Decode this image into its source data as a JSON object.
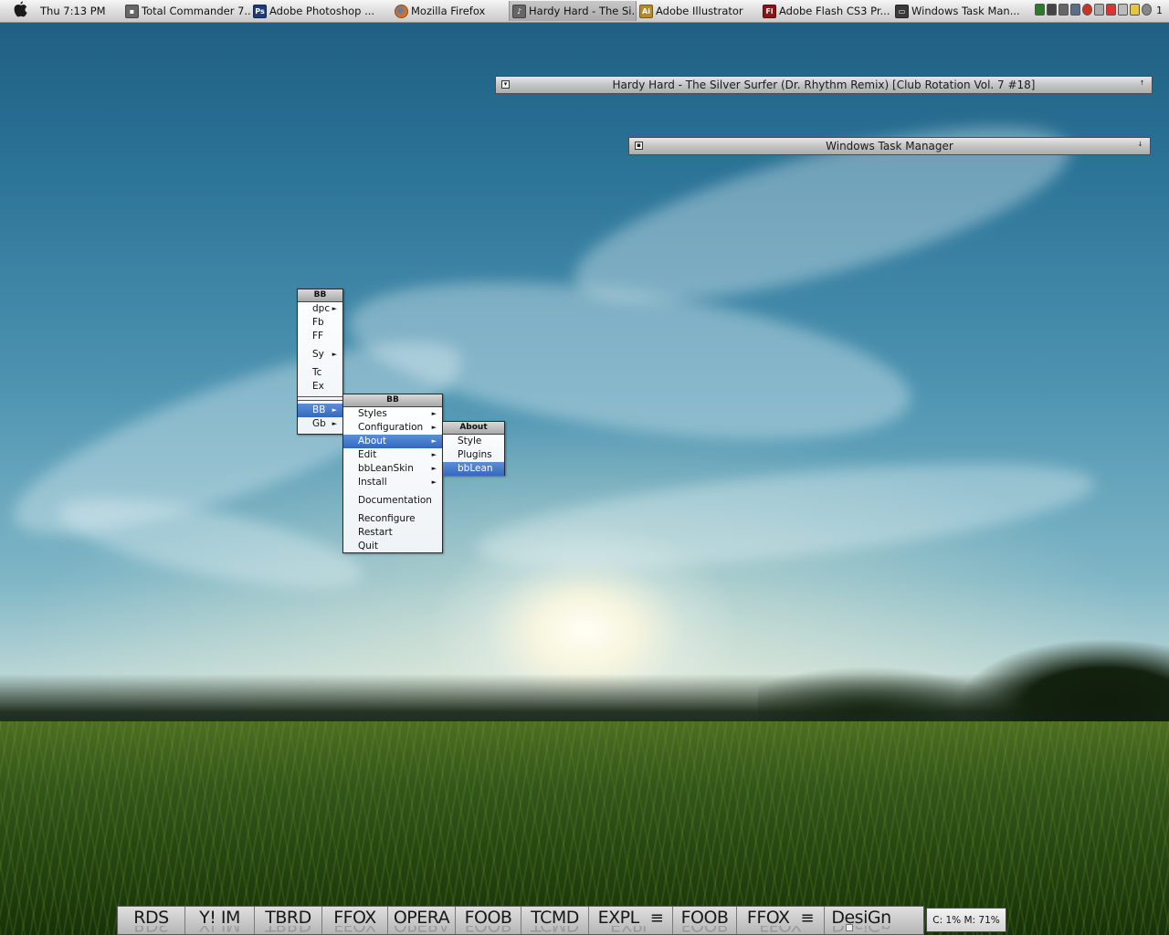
{
  "topbar": {
    "clock": "Thu 7:13 PM",
    "tasks": [
      {
        "label": "Total Commander 7...",
        "icon": "floppy-icon",
        "color": "#555555"
      },
      {
        "label": "Adobe Photoshop ...",
        "icon": "photoshop-icon",
        "color": "#1f3c7a"
      },
      {
        "label": "Mozilla Firefox",
        "icon": "firefox-icon",
        "color": "#d8731f"
      },
      {
        "label": "Hardy Hard - The Si...",
        "icon": "foobar-icon",
        "color": "#5a5a5a"
      },
      {
        "label": "Adobe Illustrator",
        "icon": "illustrator-icon",
        "color": "#b58a2a"
      },
      {
        "label": "Adobe Flash CS3 Pr...",
        "icon": "flash-icon",
        "color": "#8a1515"
      },
      {
        "label": "Windows Task Man...",
        "icon": "monitor-icon",
        "color": "#303030"
      }
    ],
    "tray_number": "1"
  },
  "windows": {
    "player_title": "Hardy Hard - The Silver Surfer (Dr. Rhythm Remix) [Club Rotation Vol. 7 #18]",
    "taskmgr_title": "Windows Task Manager"
  },
  "menus": {
    "root": {
      "title": "BB",
      "items": [
        "dpc",
        "Fb",
        "FF",
        "Sy",
        "Tc",
        "Ex",
        "BB",
        "Gb"
      ]
    },
    "bb": {
      "title": "BB",
      "items": [
        "Styles",
        "Configuration",
        "About",
        "Edit",
        "bbLeanSkin",
        "Install",
        "Documentation",
        "Reconfigure",
        "Restart",
        "Quit"
      ]
    },
    "about": {
      "title": "About",
      "items": [
        "Style",
        "Plugins",
        "bbLean"
      ]
    }
  },
  "dock": {
    "buttons": [
      "RDS",
      "Y! IM",
      "TBRD",
      "FFOX",
      "OPERA",
      "FOOB",
      "TCMD",
      "EXPL",
      "FOOB",
      "FFOX",
      "DesiGn"
    ],
    "separator": "≡",
    "status": "C: 1% M: 71%"
  },
  "colors": {
    "menu_highlight": "#3f74c8",
    "titlebar": "#b8b8b8"
  }
}
